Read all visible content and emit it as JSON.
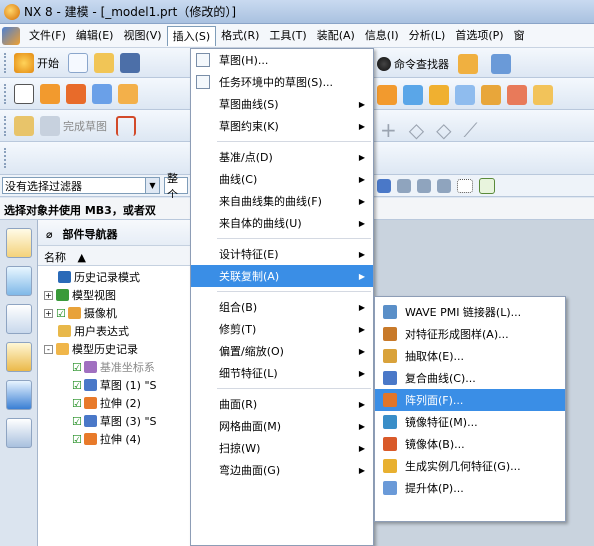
{
  "window": {
    "title": "NX 8 - 建模 - [_model1.prt（修改的）]"
  },
  "menubar": [
    "文件(F)",
    "编辑(E)",
    "视图(V)",
    "插入(S)",
    "格式(R)",
    "工具(T)",
    "装配(A)",
    "信息(I)",
    "分析(L)",
    "首选项(P)",
    "窗"
  ],
  "toolbar": {
    "start_label": "开始",
    "command_finder": "命令查找器",
    "finish_sketch": "完成草图"
  },
  "filter": {
    "value": "没有选择过滤器",
    "scope": "整个"
  },
  "cue": "选择对象并使用 MB3，或者双",
  "navigator": {
    "title": "部件导航器",
    "column": "名称",
    "rows": [
      {
        "label": "历史记录模式",
        "indent": 1
      },
      {
        "label": "模型视图",
        "indent": 0,
        "expand": "+"
      },
      {
        "label": "摄像机",
        "indent": 0,
        "expand": "+",
        "check": true
      },
      {
        "label": "用户表达式",
        "indent": 1
      },
      {
        "label": "模型历史记录",
        "indent": 0,
        "expand": "-"
      },
      {
        "label": "基准坐标系",
        "indent": 2,
        "check": true,
        "dim": true
      },
      {
        "label": "草图 (1) \"S",
        "indent": 2,
        "check": true
      },
      {
        "label": "拉伸 (2)",
        "indent": 2,
        "check": true
      },
      {
        "label": "草图 (3) \"S",
        "indent": 2,
        "check": true
      },
      {
        "label": "拉伸 (4)",
        "indent": 2,
        "check": true
      }
    ]
  },
  "insert_menu": [
    {
      "label": "草图(H)...",
      "icon": "sketch-icon"
    },
    {
      "label": "任务环境中的草图(S)...",
      "icon": "sketch-task-icon"
    },
    {
      "label": "草图曲线(S)",
      "sub": true
    },
    {
      "label": "草图约束(K)",
      "sub": true
    },
    {
      "sep": true
    },
    {
      "label": "基准/点(D)",
      "sub": true
    },
    {
      "label": "曲线(C)",
      "sub": true
    },
    {
      "label": "来自曲线集的曲线(F)",
      "sub": true
    },
    {
      "label": "来自体的曲线(U)",
      "sub": true
    },
    {
      "sep": true
    },
    {
      "label": "设计特征(E)",
      "sub": true
    },
    {
      "label": "关联复制(A)",
      "sub": true,
      "highlight": true
    },
    {
      "sep": true
    },
    {
      "label": "组合(B)",
      "sub": true
    },
    {
      "label": "修剪(T)",
      "sub": true
    },
    {
      "label": "偏置/缩放(O)",
      "sub": true
    },
    {
      "label": "细节特征(L)",
      "sub": true
    },
    {
      "sep": true
    },
    {
      "label": "曲面(R)",
      "sub": true
    },
    {
      "label": "网格曲面(M)",
      "sub": true
    },
    {
      "label": "扫掠(W)",
      "sub": true
    },
    {
      "label": "弯边曲面(G)",
      "sub": true
    }
  ],
  "assoc_copy_submenu": [
    {
      "label": "WAVE PMI 链接器(L)...",
      "color": "#5a8fc8"
    },
    {
      "label": "对特征形成图样(A)...",
      "color": "#c87a2a"
    },
    {
      "label": "抽取体(E)...",
      "color": "#d9a23a"
    },
    {
      "label": "复合曲线(C)...",
      "color": "#4a78c8"
    },
    {
      "label": "阵列面(F)...",
      "color": "#e0752a",
      "highlight": true
    },
    {
      "label": "镜像特征(M)...",
      "color": "#3a8ec8"
    },
    {
      "label": "镜像体(B)...",
      "color": "#d95a2a"
    },
    {
      "label": "生成实例几何特征(G)...",
      "color": "#e8b030"
    },
    {
      "label": "提升体(P)...",
      "color": "#6a9ad8"
    }
  ]
}
